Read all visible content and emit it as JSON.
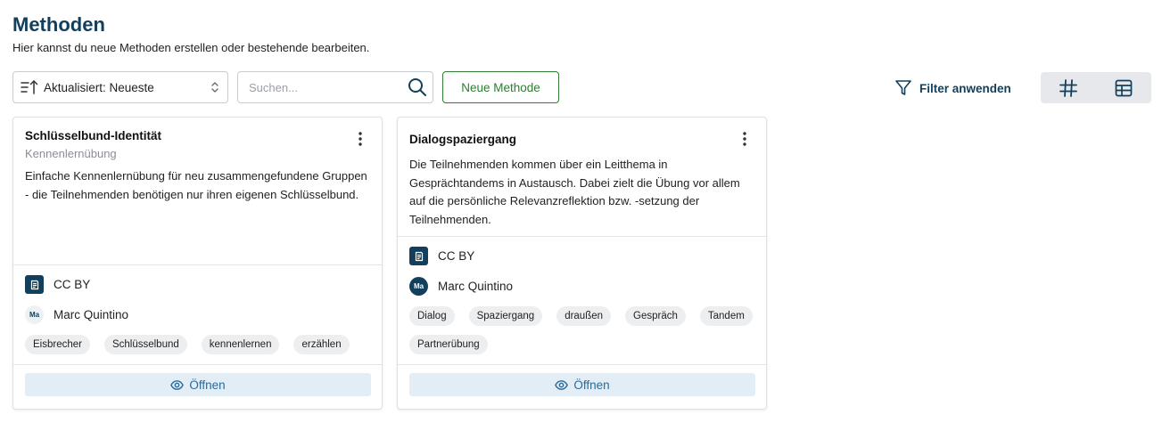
{
  "header": {
    "title": "Methoden",
    "subtitle": "Hier kannst du neue Methoden erstellen oder bestehende bearbeiten."
  },
  "toolbar": {
    "sort_label": "Aktualisiert: Neueste",
    "search_placeholder": "Suchen...",
    "search_value": "",
    "new_button_label": "Neue Methode",
    "filter_label": "Filter anwenden"
  },
  "colors": {
    "primary": "#12405c",
    "success": "#2e7d32",
    "open_button_bg": "#e3edf6",
    "open_button_text": "#2a6a98"
  },
  "cards": [
    {
      "title": "Schlüsselbund-Identität",
      "category": "Kennenlernübung",
      "description": "Einfache Kennenlernübung für neu zusammengefundene Gruppen - die Teilnehmenden benötigen nur ihren eigenen Schlüsselbund.",
      "license": "CC BY",
      "author": "Marc Quintino",
      "author_initials": "Ma",
      "tags": [
        "Eisbrecher",
        "Schlüsselbund",
        "kennenlernen",
        "erzählen"
      ],
      "open_label": "Öffnen"
    },
    {
      "title": "Dialogspaziergang",
      "category": "",
      "description": "Die Teilnehmenden kommen über ein Leitthema in Gesprächtandems in Austausch. Dabei zielt die Übung vor allem auf die persönliche Relevanzreflektion bzw. -setzung der Teilnehmenden.",
      "license": "CC BY",
      "author": "Marc Quintino",
      "author_initials": "Ma",
      "tags": [
        "Dialog",
        "Spaziergang",
        "draußen",
        "Gespräch",
        "Tandem",
        "Partnerübung"
      ],
      "open_label": "Öffnen"
    }
  ],
  "icons": {
    "sort": "sort-ascending-icon",
    "chevron": "chevron-up-down-icon",
    "search": "search-icon",
    "filter": "filter-icon",
    "grid_view": "hash-grid-icon",
    "table_view": "table-icon",
    "kebab": "more-vertical-icon",
    "license": "license-document-icon",
    "open": "eye-icon"
  }
}
